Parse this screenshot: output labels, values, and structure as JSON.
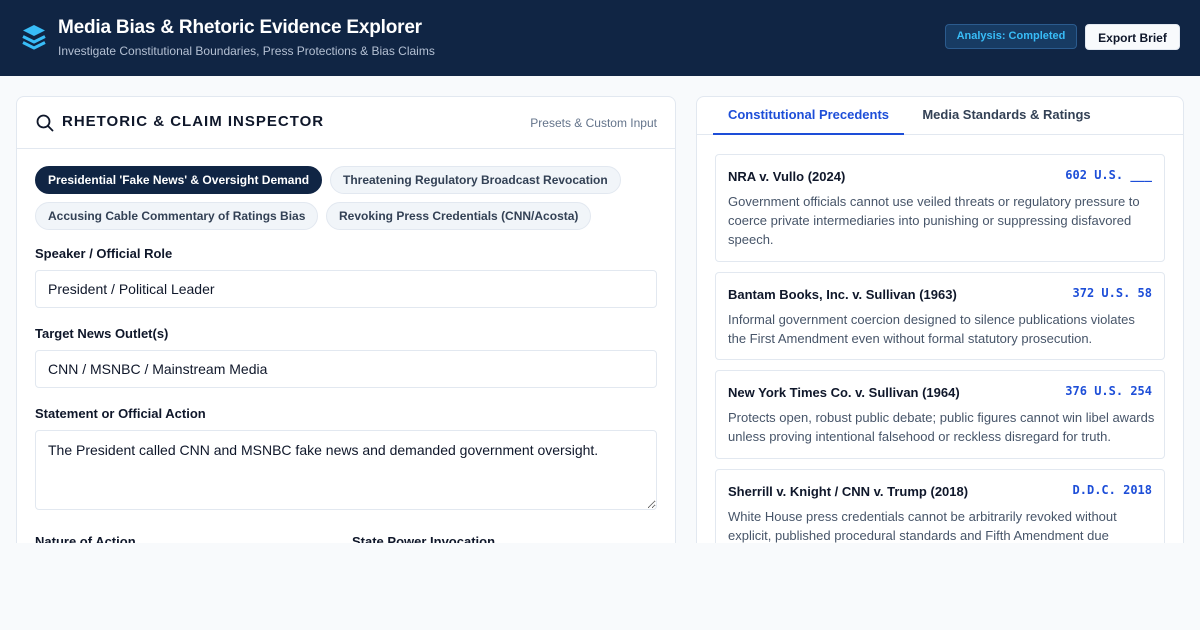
{
  "header": {
    "title": "Media Bias & Rhetoric Evidence Explorer",
    "subtitle": "Investigate Constitutional Boundaries, Press Protections & Bias Claims",
    "status_badge": "Analysis: Completed",
    "export_label": "Export Brief"
  },
  "inspector": {
    "title": "RHETORIC & CLAIM INSPECTOR",
    "hint": "Presets & Custom Input",
    "presets": [
      "Presidential 'Fake News' & Oversight Demand",
      "Threatening Regulatory Broadcast Revocation",
      "Accusing Cable Commentary of Ratings Bias",
      "Revoking Press Credentials (CNN/Acosta)"
    ],
    "fields": {
      "speaker_label": "Speaker / Official Role",
      "speaker_value": "President / Political Leader",
      "target_label": "Target News Outlet(s)",
      "target_value": "CNN / MSNBC / Mainstream Media",
      "statement_label": "Statement or Official Action",
      "statement_value": "The President called CNN and MSNBC fake news and demanded government oversight.",
      "nature_label": "Nature of Action",
      "state_power_label": "State Power Invocation"
    }
  },
  "tabs": [
    "Constitutional Precedents",
    "Media Standards & Ratings"
  ],
  "cases": [
    {
      "name": "NRA v. Vullo (2024)",
      "cite": "602 U.S. ___",
      "desc": "Government officials cannot use veiled threats or regulatory pressure to coerce private intermediaries into punishing or suppressing disfavored speech."
    },
    {
      "name": "Bantam Books, Inc. v. Sullivan (1963)",
      "cite": "372 U.S. 58",
      "desc": "Informal government coercion designed to silence publications violates the First Amendment even without formal statutory prosecution."
    },
    {
      "name": "New York Times Co. v. Sullivan (1964)",
      "cite": "376 U.S. 254",
      "desc": "Protects open, robust public debate; public figures cannot win libel awards unless proving intentional falsehood or reckless disregard for truth."
    },
    {
      "name": "Sherrill v. Knight / CNN v. Trump (2018)",
      "cite": "D.D.C. 2018",
      "desc": "White House press credentials cannot be arbitrarily revoked without explicit, published procedural standards and Fifth Amendment due"
    }
  ],
  "colors": {
    "header_bg": "#102544",
    "accent": "#1d4ed8",
    "status": "#38bdf8"
  }
}
